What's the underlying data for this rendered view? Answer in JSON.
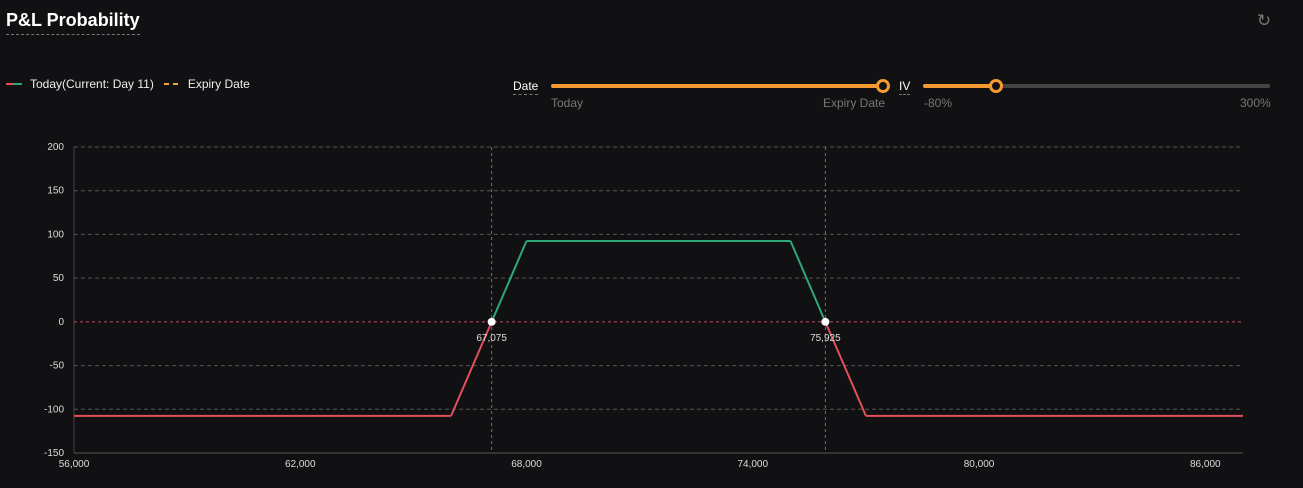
{
  "header": {
    "title": "P&L Probability",
    "refresh_icon": "refresh-icon"
  },
  "legend": {
    "today": "Today(Current: Day 11)",
    "expiry": "Expiry Date"
  },
  "controls": {
    "date": {
      "label": "Date",
      "min_label": "Today",
      "max_label": "Expiry Date",
      "value_fraction": 1.0
    },
    "iv": {
      "label": "IV",
      "min_label": "-80%",
      "max_label": "300%",
      "value_percent": 0
    }
  },
  "colors": {
    "profit": "#2fa878",
    "loss": "#e0505a",
    "accent": "#f59a32",
    "breakeven": "#c04a6a"
  },
  "chart_data": {
    "type": "line",
    "title": "P&L Probability",
    "xlabel": "",
    "ylabel": "",
    "xlim": [
      56000,
      87000
    ],
    "ylim": [
      -150,
      200
    ],
    "x_ticks": [
      56000,
      62000,
      68000,
      74000,
      80000,
      86000
    ],
    "x_tick_labels": [
      "56,000",
      "62,000",
      "68,000",
      "74,000",
      "80,000",
      "86,000"
    ],
    "y_ticks": [
      200,
      150,
      100,
      50,
      0,
      -50,
      -100,
      -150
    ],
    "grid": true,
    "series": [
      {
        "name": "Today(Current: Day 11)",
        "x": [
          56000,
          66000,
          68000,
          75000,
          77000,
          87000
        ],
        "y": [
          -107.5,
          -107.5,
          92.5,
          92.5,
          -107.5,
          -107.5
        ]
      }
    ],
    "breakevens": [
      {
        "x": 67075,
        "label": "67,075"
      },
      {
        "x": 75925,
        "label": "75,925"
      }
    ]
  }
}
